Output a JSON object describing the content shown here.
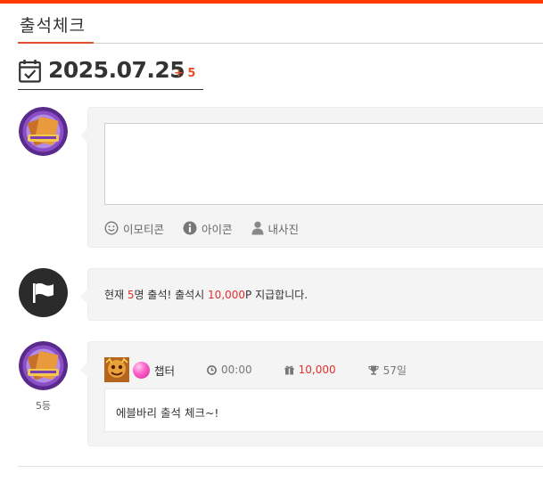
{
  "colors": {
    "accent": "#ff3a00",
    "highlight": "#e0302b",
    "panel_bg": "#f4f4f4"
  },
  "page": {
    "title": "출석체크"
  },
  "date": {
    "value": "2025.07.25",
    "increment": "+ 5",
    "icon": "calendar-check-icon"
  },
  "composer": {
    "avatar_icon": "guild-emblem-avatar",
    "tools": [
      {
        "icon": "smiley-icon",
        "label": "이모티콘"
      },
      {
        "icon": "info-icon",
        "label": "아이콘"
      },
      {
        "icon": "person-icon",
        "label": "내사진"
      }
    ]
  },
  "notice": {
    "icon": "flag-icon",
    "prefix": "현재 ",
    "count": "5",
    "mid": "명 출석! 출석시 ",
    "points": "10,000",
    "suffix": "P 지급합니다."
  },
  "entry": {
    "rank": "5등",
    "user_name": "챕터",
    "time": "00:00",
    "points": "10,000",
    "streak": "57일",
    "comment": "에블바리 출석 체크~!"
  }
}
